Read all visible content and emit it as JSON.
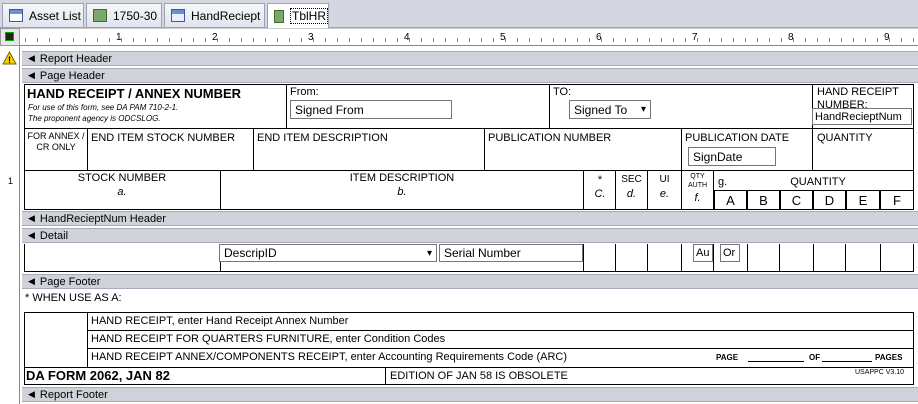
{
  "tabs": [
    {
      "label": "Asset List",
      "icon": "form-icon"
    },
    {
      "label": "1750-30",
      "icon": "table-icon"
    },
    {
      "label": "HandReciept",
      "icon": "report-icon"
    },
    {
      "label": "TblHR",
      "icon": "table-icon",
      "active": true
    }
  ],
  "ruler": {
    "numbers": [
      "1",
      "2",
      "3",
      "4",
      "5",
      "6",
      "7",
      "8",
      "9"
    ]
  },
  "gutter_numbers": [
    "1"
  ],
  "sections": {
    "report_header": "Report Header",
    "page_header": "Page Header",
    "group_header": "HandRecieptNum Header",
    "detail": "Detail",
    "page_footer": "Page Footer",
    "report_footer": "Report Footer"
  },
  "page_header": {
    "title": "HAND RECEIPT / ANNEX NUMBER",
    "use_note": "For use of this form, see DA PAM 710-2-1.",
    "agency_note": "The proponent agency is ODCSLOG.",
    "from_label": "From:",
    "from_value": "Signed From",
    "to_label": "TO:",
    "to_value": "Signed To",
    "hr_number_label": "HAND RECEIPT NUMBER:",
    "hr_number_value": "HandRecieptNum",
    "for_annex": "FOR ANNEX / CR ONLY",
    "end_item_stock": "END ITEM STOCK NUMBER",
    "end_item_desc": "END ITEM DESCRIPTION",
    "pub_number": "PUBLICATION NUMBER",
    "pub_date": "PUBLICATION DATE",
    "pub_date_value": "SignDate",
    "quantity": "QUANTITY",
    "stock_number": "STOCK NUMBER",
    "stock_letter": "a.",
    "item_desc": "ITEM DESCRIPTION",
    "item_letter": "b.",
    "star": "*",
    "c": "C.",
    "sec": "SEC",
    "d": "d.",
    "ui": "UI",
    "e": "e.",
    "qty_auth": "QTY AUTH",
    "f": "f.",
    "g": "g.",
    "qty2": "QUANTITY",
    "cols": [
      "A",
      "B",
      "C",
      "D",
      "E",
      "F"
    ]
  },
  "detail": {
    "descrip_id": "DescripID",
    "serial": "Serial Number",
    "au": "Au",
    "or": "Or"
  },
  "page_footer": {
    "when_use": "* WHEN USE AS A:",
    "line1": "HAND RECEIPT, enter Hand Receipt Annex Number",
    "line2": "HAND RECEIPT FOR QUARTERS FURNITURE, enter Condition Codes",
    "line3": "HAND RECEIPT ANNEX/COMPONENTS RECEIPT, enter Accounting Requirements Code (ARC)",
    "page_label": "PAGE",
    "of_label": "OF",
    "pages_label": "PAGES",
    "form_name": "DA FORM 2062, JAN 82",
    "edition": "EDITION OF JAN 58 IS OBSOLETE",
    "usappc": "USAPPC V3.10"
  }
}
